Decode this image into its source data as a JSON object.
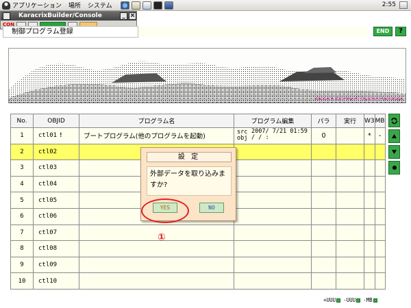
{
  "system_panel": {
    "menus": [
      "アプリケーション",
      "場所",
      "システム"
    ],
    "clock": "2:55"
  },
  "console_window": {
    "title": "KaracrixBuilder/Console",
    "minimize": "_",
    "close": "×",
    "toolbar_label": "CON"
  },
  "page": {
    "title": "制御プログラム登録",
    "end_label": "END",
    "help_label": "?"
  },
  "banner": {
    "caption": "Kanbara Yorunoyuki (syohan) Hiroshige"
  },
  "grid": {
    "headers": [
      "No.",
      "OBJID",
      "プログラム名",
      "プログラム編集",
      "パラ",
      "実行",
      "W3",
      "MB"
    ],
    "rows": [
      {
        "no": "1",
        "objid": "ctl01",
        "mark": "!",
        "name": "ブートプログラム(他のプログラムを起動)",
        "edit_src": "src",
        "edit_obj": "obj",
        "edit_date1": "2007/ 7/21 01:59",
        "edit_date2": "/ /   :",
        "para": "0",
        "run": "",
        "w3": "*",
        "mb": "-"
      },
      {
        "no": "2",
        "objid": "ctl02",
        "mark": "",
        "name": "",
        "edit_src": "",
        "edit_obj": "",
        "edit_date1": "",
        "edit_date2": "",
        "para": "",
        "run": "",
        "w3": "",
        "mb": ""
      },
      {
        "no": "3",
        "objid": "ctl03",
        "mark": "",
        "name": "",
        "edit_src": "",
        "edit_obj": "",
        "edit_date1": "",
        "edit_date2": "",
        "para": "",
        "run": "",
        "w3": "",
        "mb": ""
      },
      {
        "no": "4",
        "objid": "ctl04",
        "mark": "",
        "name": "",
        "edit_src": "",
        "edit_obj": "",
        "edit_date1": "",
        "edit_date2": "",
        "para": "",
        "run": "",
        "w3": "",
        "mb": ""
      },
      {
        "no": "5",
        "objid": "ctl05",
        "mark": "",
        "name": "",
        "edit_src": "",
        "edit_obj": "",
        "edit_date1": "",
        "edit_date2": "",
        "para": "",
        "run": "",
        "w3": "",
        "mb": ""
      },
      {
        "no": "6",
        "objid": "ctl06",
        "mark": "",
        "name": "",
        "edit_src": "",
        "edit_obj": "",
        "edit_date1": "",
        "edit_date2": "",
        "para": "",
        "run": "",
        "w3": "",
        "mb": ""
      },
      {
        "no": "7",
        "objid": "ctl07",
        "mark": "",
        "name": "",
        "edit_src": "",
        "edit_obj": "",
        "edit_date1": "",
        "edit_date2": "",
        "para": "",
        "run": "",
        "w3": "",
        "mb": ""
      },
      {
        "no": "8",
        "objid": "ctl08",
        "mark": "",
        "name": "",
        "edit_src": "",
        "edit_obj": "",
        "edit_date1": "",
        "edit_date2": "",
        "para": "",
        "run": "",
        "w3": "",
        "mb": ""
      },
      {
        "no": "9",
        "objid": "ctl09",
        "mark": "",
        "name": "",
        "edit_src": "",
        "edit_obj": "",
        "edit_date1": "",
        "edit_date2": "",
        "para": "",
        "run": "",
        "w3": "",
        "mb": ""
      },
      {
        "no": "10",
        "objid": "ctl10",
        "mark": "",
        "name": "",
        "edit_src": "",
        "edit_obj": "",
        "edit_date1": "",
        "edit_date2": "",
        "para": "",
        "run": "",
        "w3": "",
        "mb": ""
      }
    ],
    "selected_row": "2"
  },
  "side_buttons": [
    "refresh-icon",
    "up-arrow-icon",
    "down-arrow-icon",
    "dot-icon"
  ],
  "footer": {
    "plus_label": "+UUU",
    "minus_label": "-UUU",
    "mb_label": "-MB"
  },
  "dialog": {
    "title": "設 定",
    "message": "外部データを取り込みますか?",
    "yes_label": "YES",
    "no_label": "NO"
  },
  "annotation": {
    "marker": "①",
    "color": "#e02020"
  }
}
